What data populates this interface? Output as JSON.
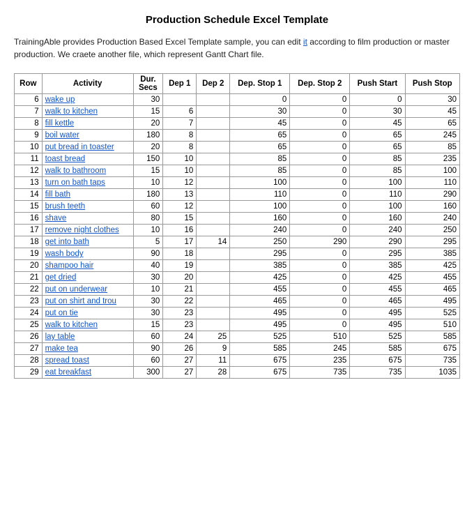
{
  "title": "Production Schedule Excel Template",
  "description": "TrainingAble provides Production Based Excel Template sample, you can edit it according to film production or master production. We craete another file, which represent Gantt Chart file.",
  "description_link_text": "it",
  "table": {
    "headers": [
      "Row",
      "Activity",
      "Dur. Secs",
      "Dep 1",
      "Dep 2",
      "Dep. Stop 1",
      "Dep. Stop 2",
      "Push Start",
      "Push Stop"
    ],
    "rows": [
      [
        6,
        "wake up",
        30,
        "",
        "",
        0,
        0,
        0,
        30
      ],
      [
        7,
        "walk to kitchen",
        15,
        6,
        "",
        30,
        0,
        30,
        45
      ],
      [
        8,
        "fill kettle",
        20,
        7,
        "",
        45,
        0,
        45,
        65
      ],
      [
        9,
        "boil water",
        180,
        8,
        "",
        65,
        0,
        65,
        245
      ],
      [
        10,
        "put bread in toaster",
        20,
        8,
        "",
        65,
        0,
        65,
        85
      ],
      [
        11,
        "toast bread",
        150,
        10,
        "",
        85,
        0,
        85,
        235
      ],
      [
        12,
        "walk to bathroom",
        15,
        10,
        "",
        85,
        0,
        85,
        100
      ],
      [
        13,
        "turn on bath taps",
        10,
        12,
        "",
        100,
        0,
        100,
        110
      ],
      [
        14,
        "fill bath",
        180,
        13,
        "",
        110,
        0,
        110,
        290
      ],
      [
        15,
        "brush teeth",
        60,
        12,
        "",
        100,
        0,
        100,
        160
      ],
      [
        16,
        "shave",
        80,
        15,
        "",
        160,
        0,
        160,
        240
      ],
      [
        17,
        "remove night clothes",
        10,
        16,
        "",
        240,
        0,
        240,
        250
      ],
      [
        18,
        "get into bath",
        5,
        17,
        14,
        250,
        290,
        290,
        295
      ],
      [
        19,
        "wash body",
        90,
        18,
        "",
        295,
        0,
        295,
        385
      ],
      [
        20,
        "shampoo hair",
        40,
        19,
        "",
        385,
        0,
        385,
        425
      ],
      [
        21,
        "get dried",
        30,
        20,
        "",
        425,
        0,
        425,
        455
      ],
      [
        22,
        "put on underwear",
        10,
        21,
        "",
        455,
        0,
        455,
        465
      ],
      [
        23,
        "put on shirt and trou",
        30,
        22,
        "",
        465,
        0,
        465,
        495
      ],
      [
        24,
        "put on tie",
        30,
        23,
        "",
        495,
        0,
        495,
        525
      ],
      [
        25,
        "walk to kitchen",
        15,
        23,
        "",
        495,
        0,
        495,
        510
      ],
      [
        26,
        "lay table",
        60,
        24,
        25,
        525,
        510,
        525,
        585
      ],
      [
        27,
        "make tea",
        90,
        26,
        9,
        585,
        245,
        585,
        675
      ],
      [
        28,
        "spread toast",
        60,
        27,
        11,
        675,
        235,
        675,
        735
      ],
      [
        29,
        "eat breakfast",
        300,
        27,
        28,
        675,
        735,
        735,
        1035
      ]
    ]
  }
}
